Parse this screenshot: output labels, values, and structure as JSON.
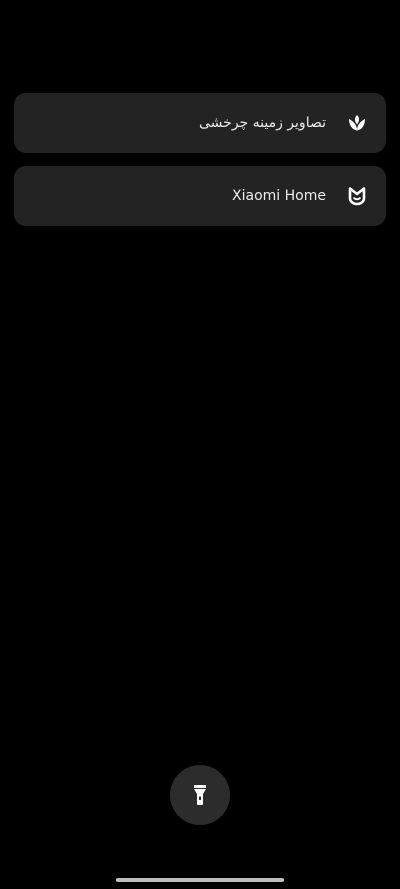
{
  "shortcuts": [
    {
      "label": "تصاویر زمینه چرخشی",
      "icon": "wallpaper-carousel-icon"
    },
    {
      "label": "Xiaomi Home",
      "icon": "mi-home-icon"
    }
  ],
  "flashlight": {
    "icon": "flashlight-icon"
  },
  "colors": {
    "background": "#000000",
    "card": "#232323",
    "text": "#ECECEC",
    "button": "#2C2C2C",
    "home_indicator": "#BDBDBD"
  }
}
